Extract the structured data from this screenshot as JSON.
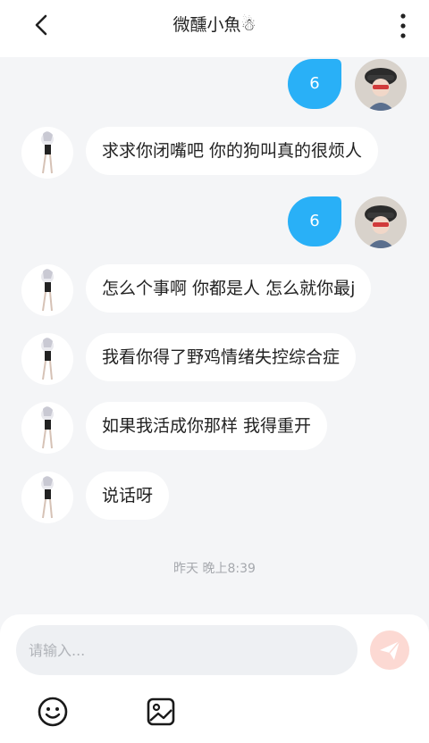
{
  "header": {
    "title": "微醺小魚☃"
  },
  "messages": [
    {
      "side": "out",
      "text": "6"
    },
    {
      "side": "in",
      "text": "求求你闭嘴吧 你的狗叫真的很烦人"
    },
    {
      "side": "out",
      "text": "6"
    },
    {
      "side": "in",
      "text": "怎么个事啊 你都是人 怎么就你最j"
    },
    {
      "side": "in",
      "text": "我看你得了野鸡情绪失控综合症"
    },
    {
      "side": "in",
      "text": "如果我活成你那样 我得重开"
    },
    {
      "side": "in",
      "text": "说话呀"
    }
  ],
  "timestamp": "昨天 晚上8:39",
  "composer": {
    "placeholder": "请输入..."
  },
  "colors": {
    "outgoing_bubble": "#29b0f7",
    "incoming_bubble": "#ffffff",
    "send_button": "#fcd9d3",
    "background": "#f4f5f7"
  },
  "icons": {
    "back": "chevron-left-icon",
    "menu": "more-vertical-icon",
    "send": "paper-plane-icon",
    "emoji": "smiley-icon",
    "image": "image-icon"
  }
}
